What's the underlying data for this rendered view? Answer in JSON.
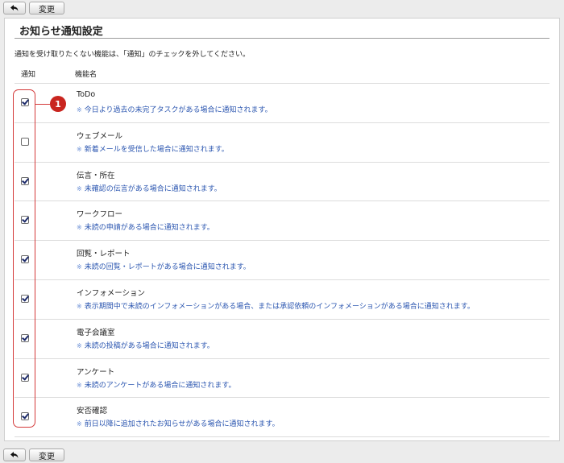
{
  "toolbar": {
    "back_icon": "back-arrow-icon",
    "change_label": "変更"
  },
  "page": {
    "title": "お知らせ通知設定",
    "intro": "通知を受け取りたくない機能は、「通知」のチェックを外してください。",
    "col_notice": "通知",
    "col_name": "機能名"
  },
  "callout": {
    "number": "1"
  },
  "features": [
    {
      "name": "ToDo",
      "desc": "今日より過去の未完了タスクがある場合に通知されます。",
      "checked": true
    },
    {
      "name": "ウェブメール",
      "desc": "新着メールを受信した場合に通知されます。",
      "checked": false
    },
    {
      "name": "伝言・所在",
      "desc": "未確認の伝言がある場合に通知されます。",
      "checked": true
    },
    {
      "name": "ワークフロー",
      "desc": "未読の申請がある場合に通知されます。",
      "checked": true
    },
    {
      "name": "回覧・レポート",
      "desc": "未読の回覧・レポートがある場合に通知されます。",
      "checked": true
    },
    {
      "name": "インフォメーション",
      "desc": "表示期間中で未読のインフォメーションがある場合、または承認依頼のインフォメーションがある場合に通知されます。",
      "checked": true
    },
    {
      "name": "電子会議室",
      "desc": "未読の投稿がある場合に通知されます。",
      "checked": true
    },
    {
      "name": "アンケート",
      "desc": "未読のアンケートがある場合に通知されます。",
      "checked": true
    },
    {
      "name": "安否確認",
      "desc": "前日以降に追加されたお知らせがある場合に通知されます。",
      "checked": true
    }
  ],
  "desc_mark": "※"
}
